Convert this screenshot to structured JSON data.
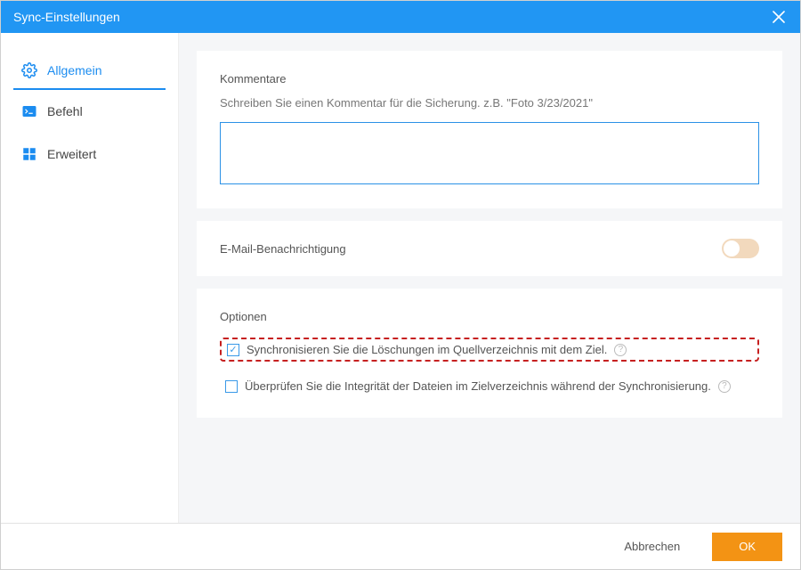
{
  "titlebar": {
    "title": "Sync-Einstellungen"
  },
  "sidebar": {
    "items": [
      {
        "label": "Allgemein",
        "icon": "gear"
      },
      {
        "label": "Befehl",
        "icon": "terminal"
      },
      {
        "label": "Erweitert",
        "icon": "grid"
      }
    ]
  },
  "comments": {
    "title": "Kommentare",
    "hint": "Schreiben Sie einen Kommentar für die Sicherung. z.B. \"Foto 3/23/2021\"",
    "value": ""
  },
  "email": {
    "label": "E-Mail-Benachrichtigung",
    "enabled": false
  },
  "options": {
    "title": "Optionen",
    "items": [
      {
        "label": "Synchronisieren Sie die Löschungen im Quellverzeichnis mit dem Ziel.",
        "checked": true,
        "highlight": true
      },
      {
        "label": "Überprüfen Sie die Integrität der Dateien im Zielverzeichnis während der Synchronisierung.",
        "checked": false,
        "highlight": false
      }
    ]
  },
  "footer": {
    "cancel": "Abbrechen",
    "ok": "OK"
  }
}
